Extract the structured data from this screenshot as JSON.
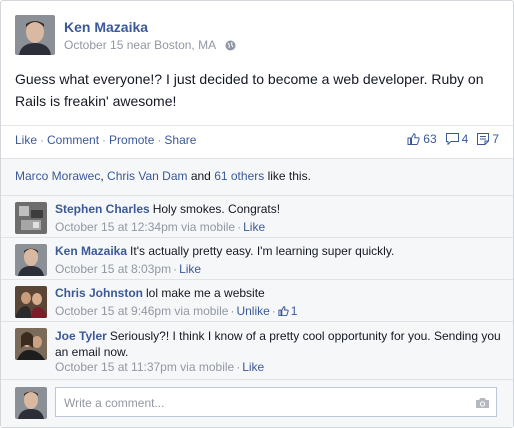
{
  "post": {
    "author": "Ken Mazaika",
    "date": "October 15",
    "location_text": "near Boston, MA",
    "text": "Guess what everyone!? I just decided to become a web developer. Ruby on Rails is freakin' awesome!"
  },
  "actions": {
    "like": "Like",
    "comment": "Comment",
    "promote": "Promote",
    "share": "Share",
    "separator": "·"
  },
  "counts": {
    "likes": "63",
    "comments": "4",
    "shares": "7"
  },
  "likes_summary": {
    "person1": "Marco Morawec",
    "separator": ", ",
    "person2": "Chris Van Dam",
    "and": " and ",
    "others": "61 others",
    "suffix": " like this."
  },
  "comments": [
    {
      "name": "Stephen Charles",
      "text": "Holy smokes. Congrats!",
      "time": "October 15 at 12:34pm via mobile",
      "like": "Like"
    },
    {
      "name": "Ken Mazaika",
      "text": "It's actually pretty easy. I'm learning super quickly.",
      "time": "October 15 at 8:03pm",
      "like": "Like"
    },
    {
      "name": "Chris Johnston",
      "text": "lol make me a website",
      "time": "October 15 at 9:46pm via mobile",
      "like": "Unlike",
      "like_count": "1"
    },
    {
      "name": "Joe Tyler",
      "text": "Seriously?! I think I know of a pretty cool opportunity for you. Sending you an email now.",
      "time": "October 15 at 11:37pm via mobile",
      "like": "Like"
    }
  ],
  "reply": {
    "placeholder": "Write a comment..."
  },
  "icons": {
    "globe": "globe-icon",
    "like": "thumbs-up-icon",
    "comment": "comment-bubble-icon",
    "share": "share-icon",
    "camera": "camera-icon"
  },
  "colors": {
    "link": "#3b5998",
    "meta": "#9197a3",
    "feedback_bg": "#f6f7f9"
  }
}
